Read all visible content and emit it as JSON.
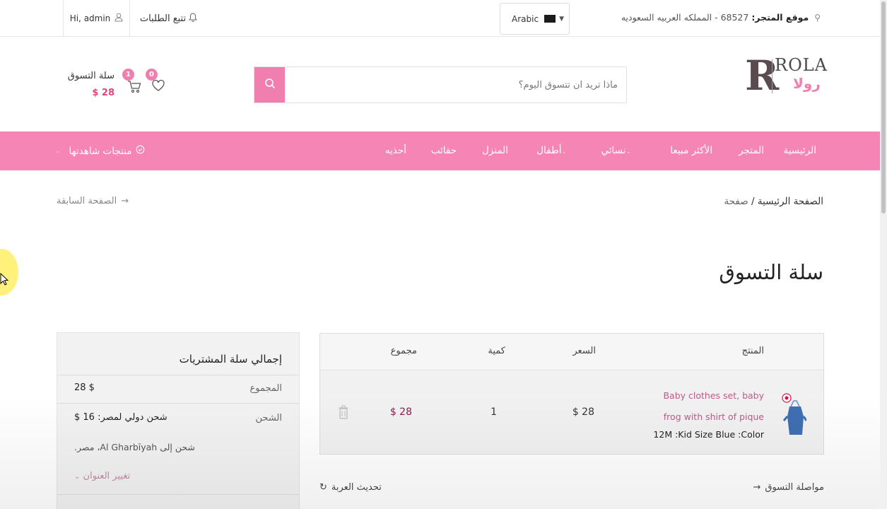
{
  "topbar": {
    "location_label": "موقع المتجر:",
    "location_value": "68527 - المملكه العربيه السعوديه",
    "language": "Arabic",
    "track_orders": "تتبع الطلبات",
    "greeting": "Hi, admin"
  },
  "header": {
    "logo_text": "ROLA",
    "logo_text_ar": "رولا",
    "search_placeholder": "ماذا تريد ان تتسوق اليوم؟",
    "cart_label": "سلة التسوق",
    "cart_total": "$ 28",
    "cart_count": "1",
    "wishlist_count": "0"
  },
  "nav": {
    "items": [
      "الرئيسية",
      "المتجر",
      "الأكثر مبيعا",
      "نسائي",
      "أطفال",
      "المنزل",
      "حقائب",
      "أحذيه"
    ],
    "viewed_products": "منتجات شاهدتها"
  },
  "breadcrumb": {
    "home": "الصفحة الرئيسية",
    "separator": "/",
    "current": "صفحة",
    "back": "الصفحة السابقة"
  },
  "page_title": "سلة التسوق",
  "cart_table": {
    "headers": {
      "product": "المنتج",
      "price": "السعر",
      "quantity": "كمية",
      "total": "مجموع"
    },
    "row": {
      "name": "Baby clothes set, baby frog with shirt of pique",
      "attributes": "12M :Kid Size Blue :Color",
      "price": "$ 28",
      "quantity": "1",
      "total": "$ 28"
    }
  },
  "summary": {
    "title": "إجمالي سلة المشتريات",
    "subtotal_label": "المجموع",
    "subtotal_value": "$ 28",
    "shipping_label": "الشحن",
    "shipping_value": "شحن دولي لمصر: 16 $",
    "shipping_note": "شحن إلى Al Gharbīyah، مصر.",
    "change_address": "تغيير العنوان"
  },
  "actions": {
    "continue": "مواصلة التسوق",
    "update": "تحديث العربة"
  },
  "colors": {
    "brand_pink": "#f485b4",
    "accent_pink": "#f07fb0",
    "price_red": "#8b1e4c"
  }
}
